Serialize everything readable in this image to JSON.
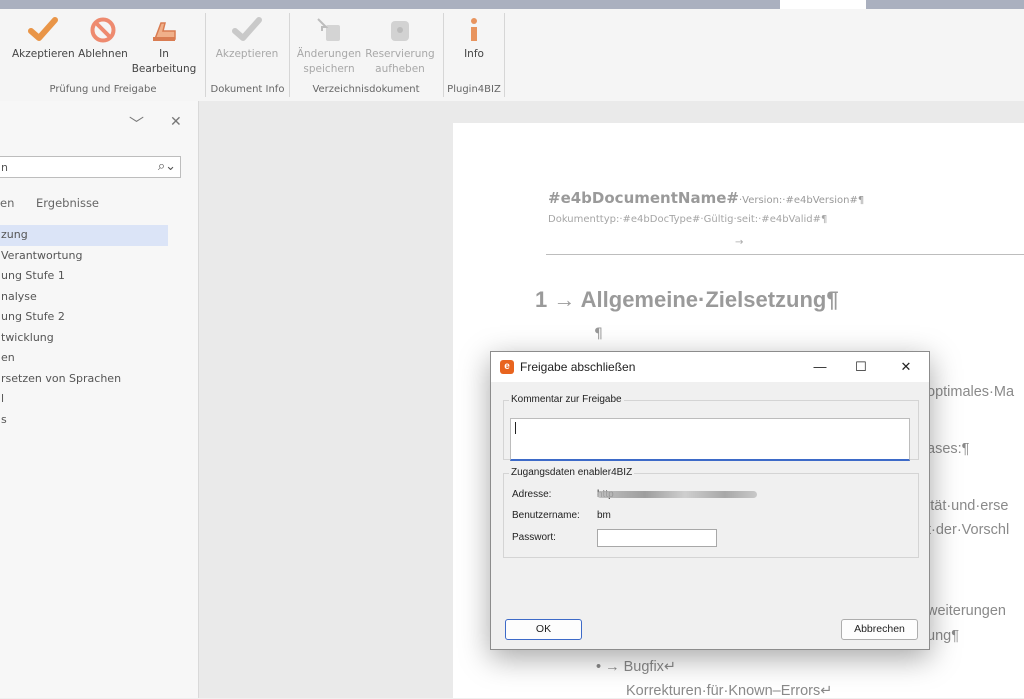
{
  "ribbon": {
    "groups": [
      {
        "label": "Prüfung und Freigabe"
      },
      {
        "label": "Dokument Info"
      },
      {
        "label": "Verzeichnisdokument"
      },
      {
        "label": "Plugin4BIZ"
      }
    ],
    "buttons": {
      "akzeptieren1": {
        "line1": "Akzeptieren",
        "line2": "",
        "icon": "check-icon"
      },
      "ablehnen": {
        "line1": "Ablehnen",
        "line2": "",
        "icon": "no-entry-icon"
      },
      "in_bearbeitung": {
        "line1": "In",
        "line2": "Bearbeitung",
        "icon": "edit-hand-icon"
      },
      "akzeptieren2": {
        "line1": "Akzeptieren",
        "line2": "",
        "icon": "check-icon"
      },
      "aenderungen": {
        "line1": "Änderungen",
        "line2": "speichern",
        "icon": "save-changes-icon"
      },
      "reservierung": {
        "line1": "Reservierung",
        "line2": "aufheben",
        "icon": "unlock-icon"
      },
      "info": {
        "line1": "Info",
        "line2": "",
        "icon": "info-icon"
      }
    }
  },
  "nav": {
    "search_text": "n",
    "tabs": [
      "en",
      "Ergebnisse"
    ],
    "items": [
      "zung",
      "Verantwortung",
      "ung Stufe 1",
      "nalyse",
      "ung Stufe 2",
      "twicklung",
      "en",
      "rsetzen von Sprachen",
      "l",
      "s"
    ],
    "selected_index": 0
  },
  "document": {
    "header_name": "#e4bDocumentName#",
    "header_version": "·Version:·#e4bVersion#¶",
    "header_line2": "Dokumenttyp:·#e4bDocType#·Gültig·seit:·#e4bValid#¶",
    "header_arrow": "→",
    "heading": "1 → Allgemeine·Zielsetzung¶",
    "pilcrow": "¶",
    "text_fragments": [
      "optimales·Ma",
      "ases:¶",
      "ität·und·erse",
      "t·der·Vorschl",
      "weiterungen",
      "ung¶",
      "• → Bugfix↵",
      "Korrekturen·für·Known–Errors↵"
    ]
  },
  "dialog": {
    "title": "Freigabe abschließen",
    "app_icon": "e",
    "comment_group": "Kommentar zur Freigabe",
    "comment_value": "",
    "access_group": "Zugangsdaten enabler4BIZ",
    "address_label": "Adresse:",
    "address_value_prefix": "http",
    "username_label": "Benutzername:",
    "username_value": "bm",
    "password_label": "Passwort:",
    "password_value": "",
    "ok_label": "OK",
    "cancel_label": "Abbrechen",
    "minimize": "—",
    "maximize": "☐",
    "close": "✕"
  },
  "colors": {
    "accent": "#3d6ac8",
    "brand_orange": "#e8641f",
    "nav_selected": "#dbe4f7"
  }
}
